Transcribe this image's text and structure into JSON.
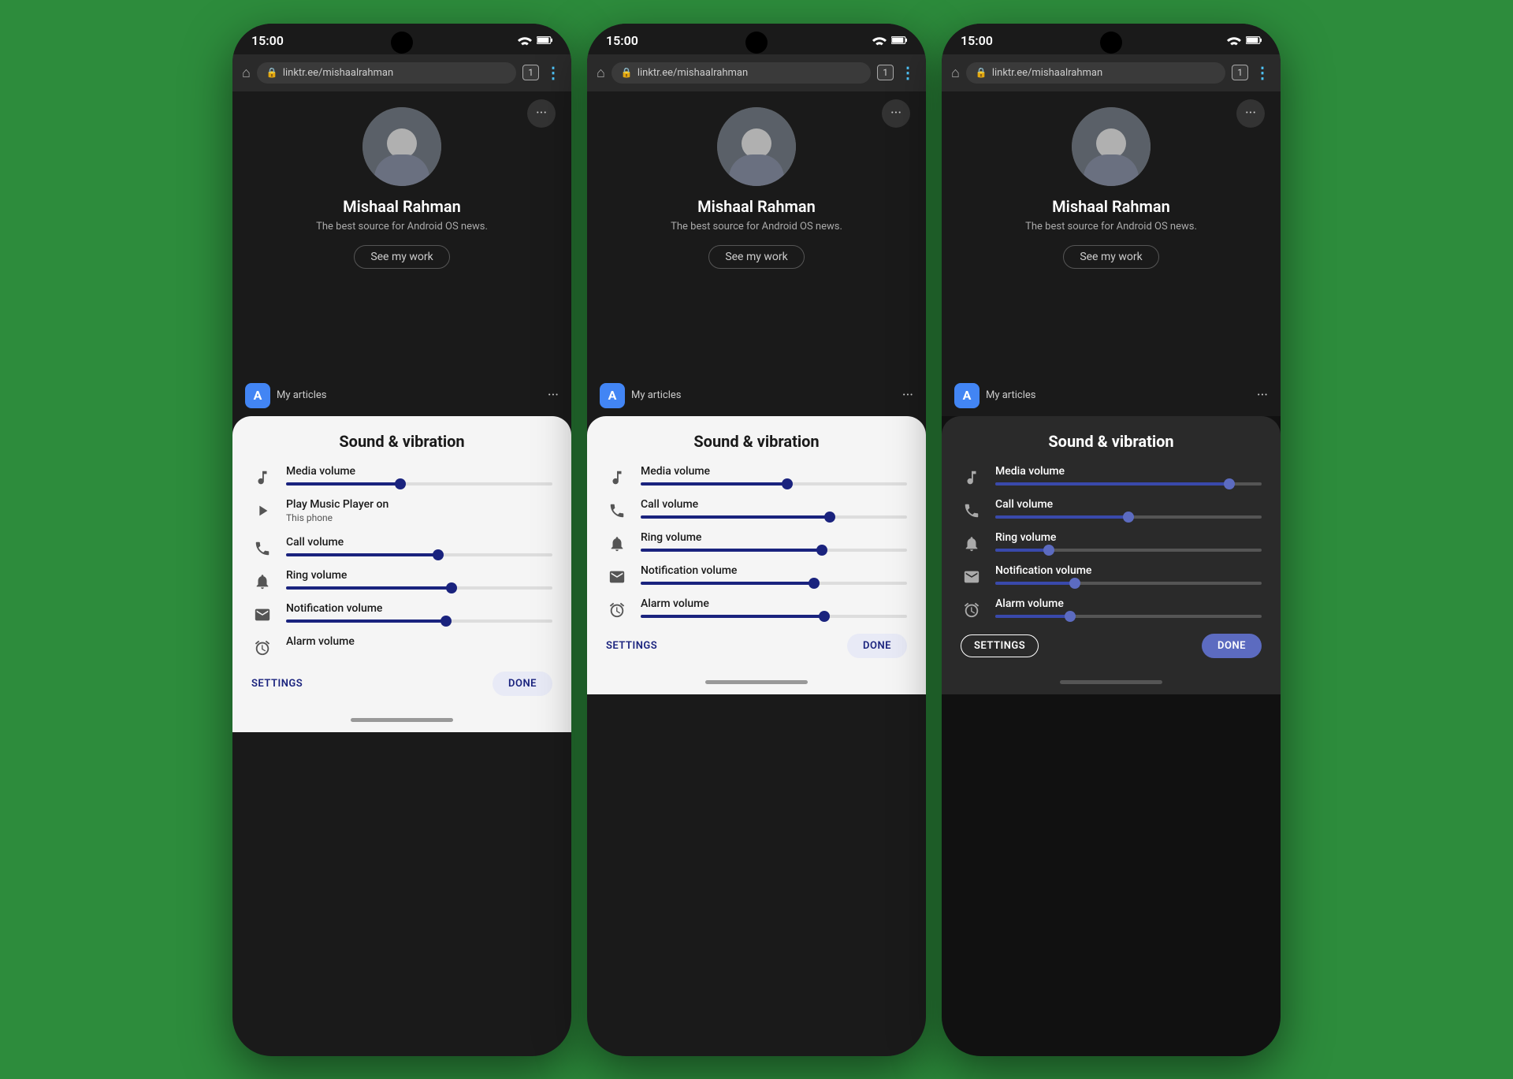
{
  "background_color": "#2d8c3c",
  "phones": [
    {
      "id": "phone-1",
      "theme": "light",
      "status_bar": {
        "time": "15:00",
        "wifi_icon": "wifi",
        "battery_icon": "battery"
      },
      "browser": {
        "url": "linktr.ee/mishaalrahman",
        "tab_count": "1"
      },
      "profile": {
        "name": "Mishaal Rahman",
        "bio": "The best source for Android OS news.",
        "see_work_label": "See my work"
      },
      "dialog": {
        "title": "Sound & vibration",
        "volumes": [
          {
            "icon": "music",
            "label": "Media volume",
            "sublabel": null,
            "fill_percent": 43,
            "has_sublabel": false
          },
          {
            "icon": "music-play",
            "label": "Play Music Player on",
            "sublabel": "This phone",
            "fill_percent": 0,
            "has_sublabel": true,
            "is_info": true
          },
          {
            "icon": "phone",
            "label": "Call volume",
            "sublabel": null,
            "fill_percent": 57,
            "has_sublabel": false
          },
          {
            "icon": "ring",
            "label": "Ring volume",
            "sublabel": null,
            "fill_percent": 62,
            "has_sublabel": false
          },
          {
            "icon": "notification",
            "label": "Notification volume",
            "sublabel": null,
            "fill_percent": 60,
            "has_sublabel": false
          },
          {
            "icon": "alarm",
            "label": "Alarm volume",
            "sublabel": null,
            "fill_percent": 0,
            "has_sublabel": false,
            "no_slider": true
          }
        ],
        "settings_label": "SETTINGS",
        "done_label": "DONE"
      }
    },
    {
      "id": "phone-2",
      "theme": "light",
      "status_bar": {
        "time": "15:00",
        "wifi_icon": "wifi",
        "battery_icon": "battery"
      },
      "browser": {
        "url": "linktr.ee/mishaalrahman",
        "tab_count": "1"
      },
      "profile": {
        "name": "Mishaal Rahman",
        "bio": "The best source for Android OS news.",
        "see_work_label": "See my work"
      },
      "dialog": {
        "title": "Sound & vibration",
        "volumes": [
          {
            "icon": "music",
            "label": "Media volume",
            "sublabel": null,
            "fill_percent": 55,
            "has_sublabel": false
          },
          {
            "icon": "phone",
            "label": "Call volume",
            "sublabel": null,
            "fill_percent": 71,
            "has_sublabel": false
          },
          {
            "icon": "ring",
            "label": "Ring volume",
            "sublabel": null,
            "fill_percent": 68,
            "has_sublabel": false
          },
          {
            "icon": "notification",
            "label": "Notification volume",
            "sublabel": null,
            "fill_percent": 65,
            "has_sublabel": false
          },
          {
            "icon": "alarm",
            "label": "Alarm volume",
            "sublabel": null,
            "fill_percent": 69,
            "has_sublabel": false
          }
        ],
        "settings_label": "SETTINGS",
        "done_label": "DONE"
      }
    },
    {
      "id": "phone-3",
      "theme": "dark",
      "status_bar": {
        "time": "15:00",
        "wifi_icon": "wifi",
        "battery_icon": "battery"
      },
      "browser": {
        "url": "linktr.ee/mishaalrahman",
        "tab_count": "1"
      },
      "profile": {
        "name": "Mishaal Rahman",
        "bio": "The best source for Android OS news.",
        "see_work_label": "See my work"
      },
      "dialog": {
        "title": "Sound & vibration",
        "volumes": [
          {
            "icon": "music",
            "label": "Media volume",
            "sublabel": null,
            "fill_percent": 88,
            "has_sublabel": false
          },
          {
            "icon": "phone",
            "label": "Call volume",
            "sublabel": null,
            "fill_percent": 50,
            "has_sublabel": false
          },
          {
            "icon": "ring",
            "label": "Ring volume",
            "sublabel": null,
            "fill_percent": 20,
            "has_sublabel": false
          },
          {
            "icon": "notification",
            "label": "Notification volume",
            "sublabel": null,
            "fill_percent": 30,
            "has_sublabel": false
          },
          {
            "icon": "alarm",
            "label": "Alarm volume",
            "sublabel": null,
            "fill_percent": 28,
            "has_sublabel": false
          }
        ],
        "settings_label": "SETTINGS",
        "done_label": "DONE"
      }
    }
  ]
}
